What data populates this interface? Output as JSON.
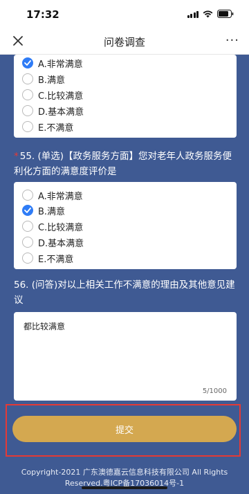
{
  "status": {
    "time": "17:32"
  },
  "nav": {
    "title": "问卷调查",
    "more": "···"
  },
  "q54": {
    "options": [
      {
        "label": "A.非常满意",
        "checked": true
      },
      {
        "label": "B.满意",
        "checked": false
      },
      {
        "label": "C.比较满意",
        "checked": false
      },
      {
        "label": "D.基本满意",
        "checked": false
      },
      {
        "label": "E.不满意",
        "checked": false
      }
    ]
  },
  "q55": {
    "required_mark": "*",
    "text": "55. (单选)【政务服务方面】您对老年人政务服务便利化方面的满意度评价是",
    "options": [
      {
        "label": "A.非常满意",
        "checked": false
      },
      {
        "label": "B.满意",
        "checked": true
      },
      {
        "label": "C.比较满意",
        "checked": false
      },
      {
        "label": "D.基本满意",
        "checked": false
      },
      {
        "label": "E.不满意",
        "checked": false
      }
    ]
  },
  "q56": {
    "text": "56. (问答)对以上相关工作不满意的理由及其他意见建议",
    "answer": "都比较满意",
    "counter": "5/1000"
  },
  "submit": {
    "label": "提交"
  },
  "footer": {
    "line1": "Copyright-2021 广东澳德嘉云信息科技有限公司 All Rights",
    "line2": "Reserved.粤ICP备17036014号-1"
  }
}
